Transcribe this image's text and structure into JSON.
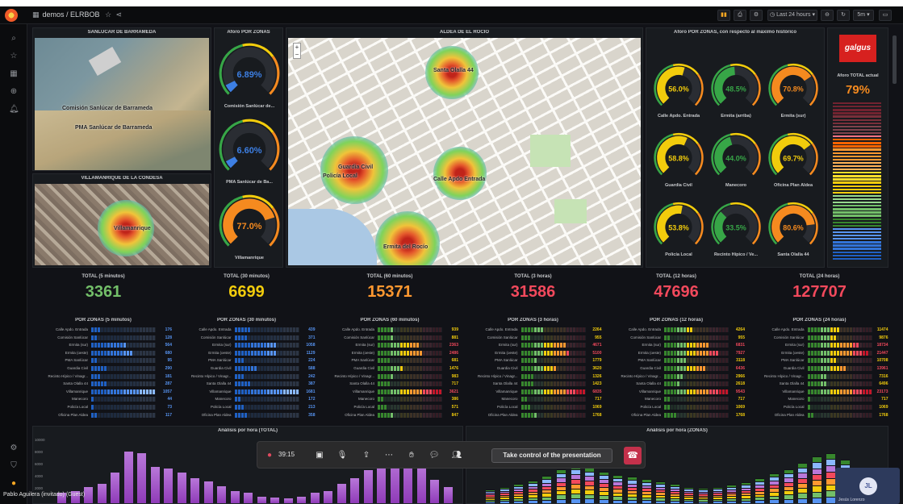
{
  "topbar": {
    "breadcrumb": "demos / ELRBOB",
    "star_icon": "star-icon",
    "share_icon": "share-icon",
    "time_range": "Last 24 hours",
    "refresh": "5m"
  },
  "panels": {
    "aerial_top_title": "SANLÚCAR DE BARRAMEDA",
    "aerial_top_labels": [
      "Comisión Sanlúcar de Barrameda",
      "PMA Sanlúcar de Barrameda"
    ],
    "aerial_bottom_title": "VILLAMANRIQUE DE LA CONDESA",
    "aerial_bottom_label": "Villamanrique",
    "gauge_col_title": "Aforo POR ZONAS",
    "street_map_title": "ALDEA DE EL ROCÍO",
    "street_map_labels": [
      "Santa Olalla 44",
      "Guardia Civil",
      "Policía Local",
      "Calle Apdo Entrada",
      "Ermita del Rocío"
    ],
    "gauge_grid_title": "Aforo POR ZONAS, con respecto al máximo histórico",
    "logo_text": "galgus",
    "aforo_total_title": "Aforo TOTAL actual",
    "aforo_total_value": "79%"
  },
  "side_gauges": [
    {
      "value": "6.89%",
      "label": "Comisión Sanlúcar de...",
      "pct": 0.069,
      "color": "#3d7fe3"
    },
    {
      "value": "6.60%",
      "label": "PMA Sanlúcar de Ba...",
      "pct": 0.066,
      "color": "#3d7fe3"
    },
    {
      "value": "77.0%",
      "label": "Villamanrique",
      "pct": 0.77,
      "color": "#f58a1f"
    }
  ],
  "grid_gauges": [
    {
      "value": "56.0%",
      "label": "Calle Apdo. Entrada",
      "pct": 0.56,
      "color": "#f2cc0c"
    },
    {
      "value": "48.5%",
      "label": "Ermita (arriba)",
      "pct": 0.485,
      "color": "#37a647"
    },
    {
      "value": "70.8%",
      "label": "Ermita (sur)",
      "pct": 0.708,
      "color": "#f58a1f"
    },
    {
      "value": "58.8%",
      "label": "Guardia Civil",
      "pct": 0.588,
      "color": "#f2cc0c"
    },
    {
      "value": "44.0%",
      "label": "Manecoro",
      "pct": 0.44,
      "color": "#37a647"
    },
    {
      "value": "69.7%",
      "label": "Oficina Plan Aldea",
      "pct": 0.697,
      "color": "#f2cc0c"
    },
    {
      "value": "53.8%",
      "label": "Policía Local",
      "pct": 0.538,
      "color": "#f2cc0c"
    },
    {
      "value": "33.5%",
      "label": "Recinto Hípico / Ve...",
      "pct": 0.335,
      "color": "#37a647"
    },
    {
      "value": "80.6%",
      "label": "Santa Olalla 44",
      "pct": 0.806,
      "color": "#f58a1f"
    }
  ],
  "totals": [
    {
      "title": "TOTAL (5 minutos)",
      "value": "3361",
      "color": "#73bf69"
    },
    {
      "title": "TOTAL (30 minutos)",
      "value": "6699",
      "color": "#f2cc0c"
    },
    {
      "title": "TOTAL (60 minutos)",
      "value": "15371",
      "color": "#ff9830"
    },
    {
      "title": "TOTAL (3 horas)",
      "value": "31586",
      "color": "#f2495c"
    },
    {
      "title": "TOTAL (12 horas)",
      "value": "47696",
      "color": "#f2495c"
    },
    {
      "title": "TOTAL (24 horas)",
      "value": "127707",
      "color": "#f2495c"
    }
  ],
  "zone_labels": [
    "Calle Apdo. Entrada",
    "Comisión Sanlúcar",
    "Ermita (sur)",
    "Ermita (oeste)",
    "PMA Sanlúcar",
    "Guardia Civil",
    "Recinto Hípico / Vinagr...",
    "Santa Olalla 44",
    "Villamanrique",
    "Manecoro",
    "Policía Local",
    "Oficina Plan Aldea"
  ],
  "zone_panels": [
    {
      "title": "POR ZONAS (5 minutos)",
      "palette": "blue",
      "values": [
        "176",
        "128",
        "564",
        "680",
        "95",
        "290",
        "181",
        "287",
        "1057",
        "44",
        "73",
        "117"
      ]
    },
    {
      "title": "POR ZONAS (30 minutos)",
      "palette": "blue",
      "values": [
        "439",
        "371",
        "1058",
        "1129",
        "224",
        "588",
        "242",
        "387",
        "1681",
        "172",
        "213",
        "358"
      ]
    },
    {
      "title": "POR ZONAS (60 minutos)",
      "palette": "warm",
      "values": [
        "939",
        "881",
        "2363",
        "2486",
        "681",
        "1476",
        "983",
        "717",
        "3621",
        "386",
        "571",
        "847"
      ]
    },
    {
      "title": "POR ZONAS (3 horas)",
      "palette": "warm",
      "values": [
        "2264",
        "955",
        "4671",
        "5100",
        "1779",
        "3620",
        "1326",
        "1423",
        "6835",
        "717",
        "1069",
        "1768"
      ]
    },
    {
      "title": "POR ZONAS (12 horas)",
      "palette": "warm",
      "values": [
        "4264",
        "955",
        "6831",
        "7927",
        "3118",
        "6436",
        "2966",
        "2618",
        "9543",
        "717",
        "1069",
        "1768"
      ]
    },
    {
      "title": "POR ZONAS (24 horas)",
      "palette": "warm",
      "values": [
        "11474",
        "9876",
        "18734",
        "21447",
        "10708",
        "13961",
        "7316",
        "6496",
        "23173",
        "717",
        "1069",
        "1768"
      ]
    }
  ],
  "bottom_charts": [
    {
      "title": "Análisis por hora (TOTAL)"
    },
    {
      "title": "Análisis por hora (ZONAS)"
    }
  ],
  "bottom_axis_ticks": [
    "10000",
    "8000",
    "6000",
    "4000",
    "2000"
  ],
  "meeting": {
    "timer": "39:15",
    "take_control": "Take control of the presentation",
    "presenter": "Pablo Aguilera (invitado) (Guest)",
    "participant_initials": "JL",
    "participant_name": "Jesús Lorenzo"
  },
  "colors": {
    "grafana_bg": "#111217",
    "panel_bg": "#181b1f",
    "hangup": "#c4314b"
  }
}
